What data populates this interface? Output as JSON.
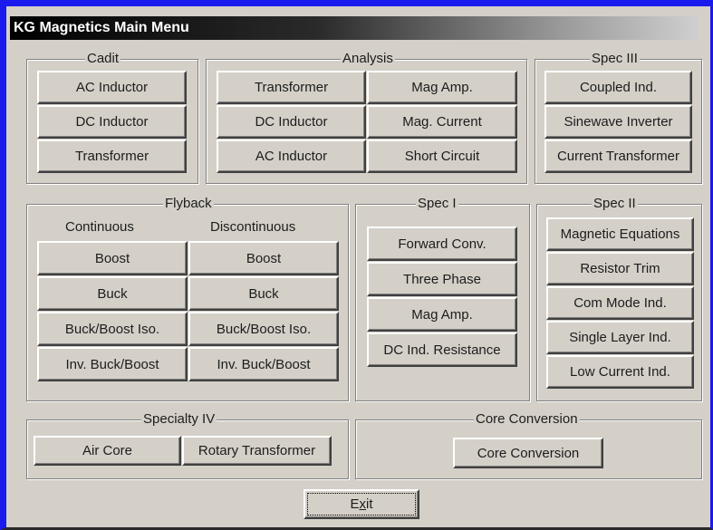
{
  "window": {
    "title": "KG Magnetics Main Menu"
  },
  "cadit": {
    "label": "Cadit",
    "buttons": [
      "AC Inductor",
      "DC Inductor",
      "Transformer"
    ]
  },
  "analysis": {
    "label": "Analysis",
    "left": [
      "Transformer",
      "DC Inductor",
      "AC Inductor"
    ],
    "right": [
      "Mag Amp.",
      "Mag. Current",
      "Short Circuit"
    ]
  },
  "spec3": {
    "label": "Spec III",
    "buttons": [
      "Coupled Ind.",
      "Sinewave Inverter",
      "Current Transformer"
    ]
  },
  "flyback": {
    "label": "Flyback",
    "continuous_label": "Continuous",
    "discontinuous_label": "Discontinuous",
    "continuous": [
      "Boost",
      "Buck",
      "Buck/Boost Iso.",
      "Inv. Buck/Boost"
    ],
    "discontinuous": [
      "Boost",
      "Buck",
      "Buck/Boost Iso.",
      "Inv. Buck/Boost"
    ]
  },
  "spec1": {
    "label": "Spec I",
    "buttons": [
      "Forward Conv.",
      "Three Phase",
      "Mag Amp.",
      "DC Ind. Resistance"
    ]
  },
  "spec2": {
    "label": "Spec II",
    "buttons": [
      "Magnetic Equations",
      "Resistor Trim",
      "Com Mode Ind.",
      "Single Layer Ind.",
      "Low Current Ind."
    ]
  },
  "specialty4": {
    "label": "Specialty IV",
    "buttons": [
      "Air Core",
      "Rotary Transformer"
    ]
  },
  "core_conversion": {
    "label": "Core Conversion",
    "button": "Core Conversion"
  },
  "exit": {
    "prefix": "E",
    "accel": "x",
    "suffix": "it"
  }
}
